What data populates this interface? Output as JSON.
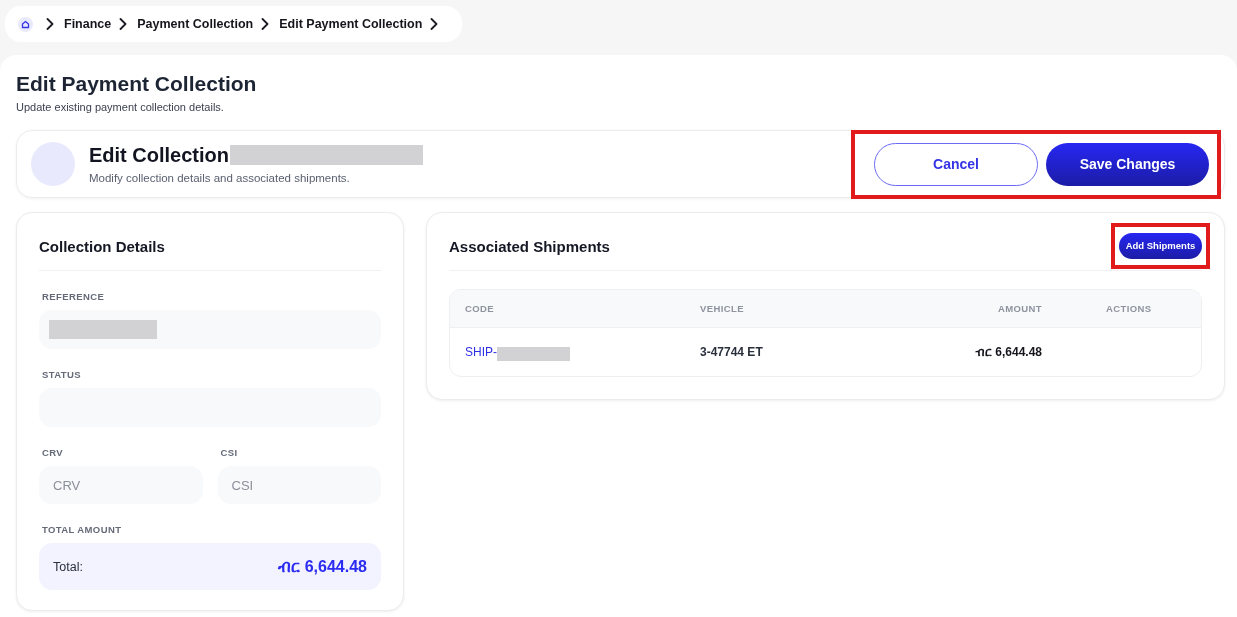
{
  "breadcrumb": {
    "items": [
      {
        "label": "Finance"
      },
      {
        "label": "Payment Collection"
      },
      {
        "label": "Edit Payment Collection"
      }
    ]
  },
  "page": {
    "title": "Edit Payment Collection",
    "subtitle": "Update existing payment collection details."
  },
  "header_card": {
    "title": "Edit Collection",
    "title_redacted": true,
    "subtitle": "Modify collection details and associated shipments.",
    "actions_highlighted": true,
    "buttons": [
      {
        "label": "Cancel",
        "kind": "outline"
      },
      {
        "label": "Save Changes",
        "kind": "primary"
      }
    ]
  },
  "collection_details": {
    "title": "Collection Details",
    "fields": [
      {
        "kind": "single",
        "label": "REFERENCE",
        "redacted": true
      },
      {
        "kind": "single",
        "label": "STATUS"
      },
      {
        "kind": "pair",
        "items": [
          {
            "label": "CRV",
            "placeholder": "CRV"
          },
          {
            "label": "CSI",
            "placeholder": "CSI"
          }
        ]
      }
    ],
    "total": {
      "label": "TOTAL AMOUNT",
      "caption": "Total:",
      "value": "ብር 6,644.48"
    }
  },
  "shipments": {
    "title": "Associated Shipments",
    "add_button": {
      "label": "Add Shipments",
      "highlighted": true
    },
    "table": {
      "columns": [
        "CODE",
        "VEHICLE",
        "AMOUNT",
        "ACTIONS"
      ],
      "rows": [
        {
          "code": "SHIP-",
          "code_redacted": true,
          "vehicle": "3-47744 ET",
          "amount": "ብር 6,644.48"
        }
      ]
    }
  }
}
